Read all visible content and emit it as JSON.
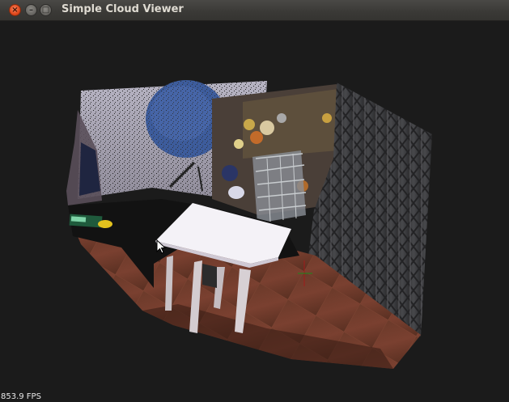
{
  "window": {
    "title": "Simple Cloud Viewer",
    "controls": {
      "close_icon": "close-icon",
      "minimize_icon": "minimize-icon",
      "maximize_icon": "maximize-icon"
    }
  },
  "viewer": {
    "fps_text": "853.9 FPS",
    "background_color": "#1b1b1b",
    "scene": "point cloud of a room with a white table, blue satellite dish, shelves and a metal gate"
  },
  "colors": {
    "close_button": "#e0471b",
    "titlebar": "#3a3936",
    "title_text": "#dfdbd2"
  }
}
